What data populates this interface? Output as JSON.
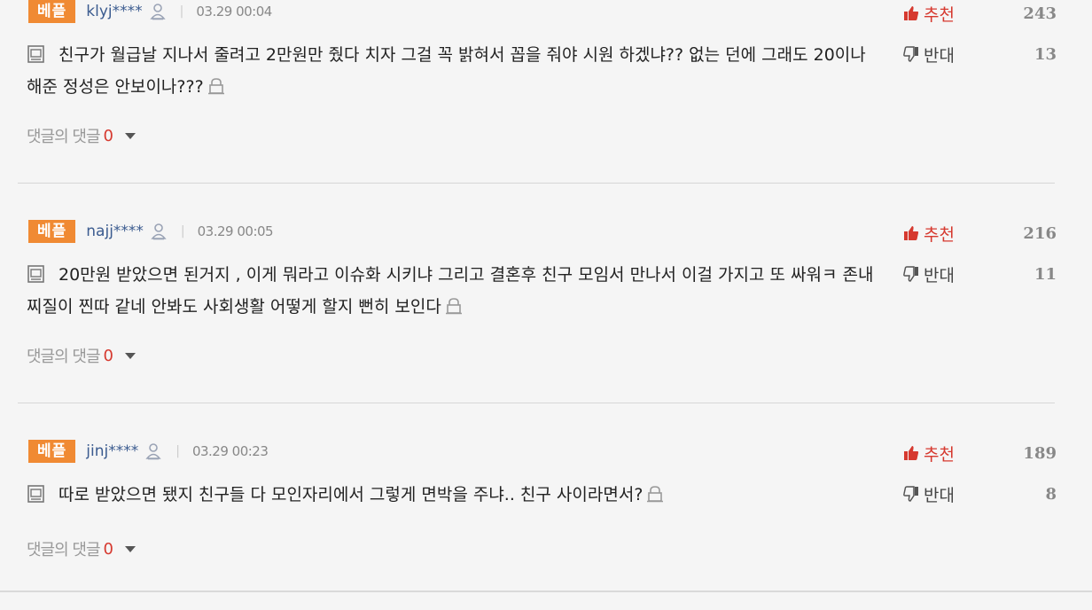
{
  "comments": [
    {
      "badge": "베플",
      "username": "klyj****",
      "date": "03.29 00:04",
      "text": "친구가 월급날 지나서 줄려고 2만원만 줬다 치자 그걸 꼭 밝혀서 꼽을 줘야 시원 하겠냐?? 없는 던에 그래도 20이나 해준 정성은 안보이나???",
      "upvote_label": "추천",
      "upvotes": "243",
      "downvote_label": "반대",
      "downvotes": "13",
      "reply_label": "댓글의 댓글",
      "reply_count": "0"
    },
    {
      "badge": "베플",
      "username": "najj****",
      "date": "03.29 00:05",
      "text": "20만원 받았으면 된거지 , 이게 뭐라고 이슈화 시키냐 그리고 결혼후 친구 모임서 만나서 이걸 가지고 또 싸워ㅋ 존내 찌질이 찐따 같네 안봐도 사회생활 어떻게 할지 뻔히 보인다",
      "upvote_label": "추천",
      "upvotes": "216",
      "downvote_label": "반대",
      "downvotes": "11",
      "reply_label": "댓글의 댓글",
      "reply_count": "0"
    },
    {
      "badge": "베플",
      "username": "jinj****",
      "date": "03.29 00:23",
      "text": "따로 받았으면 됐지 친구들 다 모인자리에서 그렇게 면박을 주냐.. 친구 사이라면서?",
      "upvote_label": "추천",
      "upvotes": "189",
      "downvote_label": "반대",
      "downvotes": "8",
      "reply_label": "댓글의 댓글",
      "reply_count": "0"
    }
  ],
  "colors": {
    "badge": "#f08a33",
    "username": "#3b5b8f",
    "upvote": "#d6392f",
    "reply_count": "#d6392f"
  },
  "icons": {
    "user": "user-icon",
    "thumbs_up": "thumbs-up-icon",
    "thumbs_down": "thumbs-down-icon",
    "document": "document-icon",
    "lock": "lock-icon",
    "caret": "caret-down-icon"
  }
}
